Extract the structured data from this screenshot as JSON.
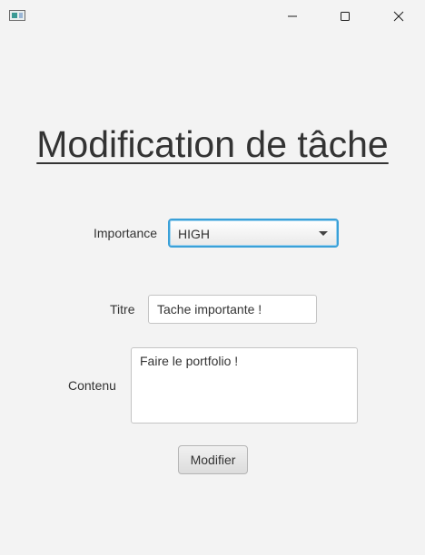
{
  "window": {
    "icon": "app-icon",
    "controls": {
      "minimize": "minimize-icon",
      "maximize": "maximize-icon",
      "close": "close-icon"
    }
  },
  "form": {
    "title": "Modification de tâche",
    "importance": {
      "label": "Importance",
      "selected": "HIGH"
    },
    "titre": {
      "label": "Titre",
      "value": "Tache importante !"
    },
    "contenu": {
      "label": "Contenu",
      "value": "Faire le portfolio !"
    },
    "submit_label": "Modifier"
  },
  "colors": {
    "background": "#f3f3f3",
    "focus_border": "#3aa0d8",
    "text": "#333333"
  }
}
